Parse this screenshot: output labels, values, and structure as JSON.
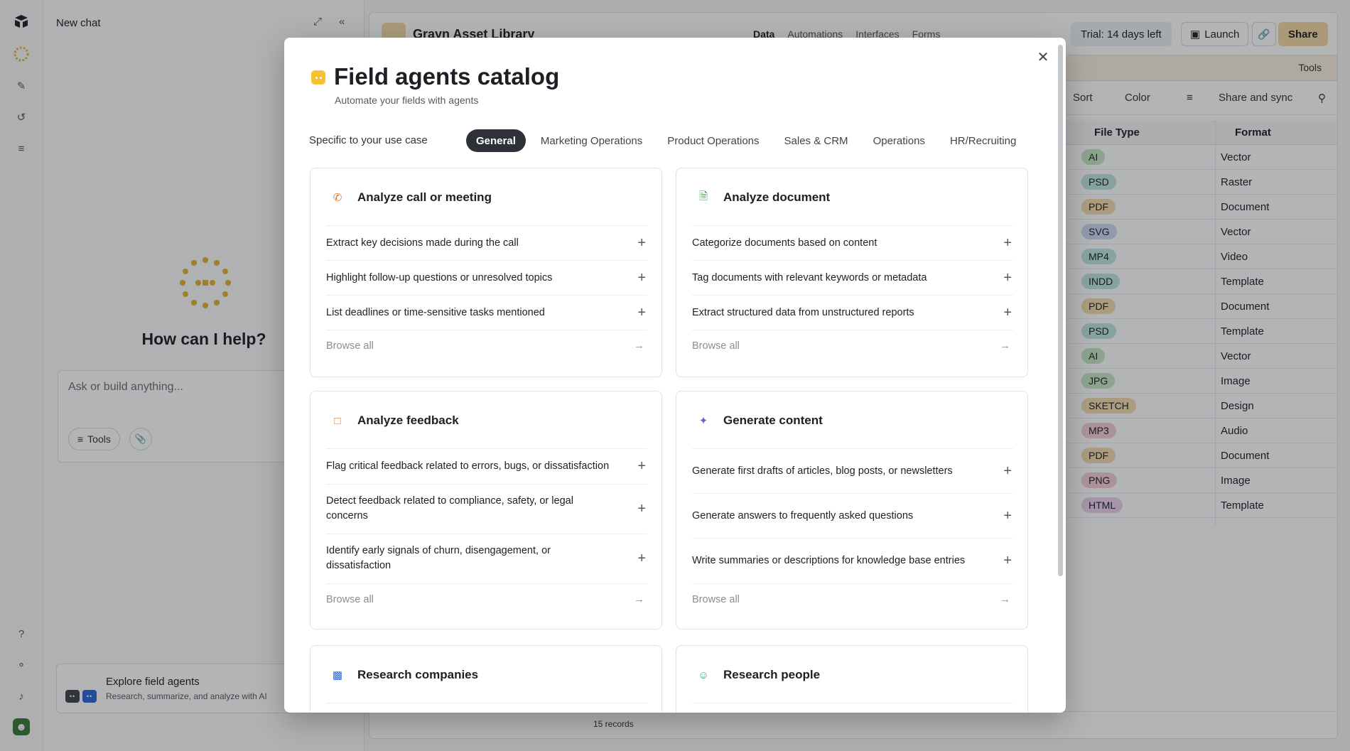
{
  "chat": {
    "title": "New chat",
    "heading": "How can I help?",
    "input_placeholder": "Ask or build anything...",
    "tools_label": "Tools",
    "explore_title": "Explore field agents",
    "explore_subtitle": "Research, summarize, and analyze with AI"
  },
  "base": {
    "name": "Grayn Asset Library",
    "nav": [
      "Data",
      "Automations",
      "Interfaces",
      "Forms"
    ],
    "trial": "Trial: 14 days left",
    "launch": "Launch",
    "share": "Share",
    "tools": "Tools",
    "view_buttons": {
      "sort": "Sort",
      "color": "Color",
      "share_sync": "Share and sync"
    },
    "columns": {
      "file_type": "File Type",
      "format": "Format"
    },
    "rows": [
      {
        "type": "AI",
        "format": "Vector",
        "color": "#c6e8c4"
      },
      {
        "type": "PSD",
        "format": "Raster",
        "color": "#bfe6e2"
      },
      {
        "type": "PDF",
        "format": "Document",
        "color": "#f3dcb0"
      },
      {
        "type": "SVG",
        "format": "Vector",
        "color": "#cdd8f2"
      },
      {
        "type": "MP4",
        "format": "Video",
        "color": "#bfe6e2"
      },
      {
        "type": "INDD",
        "format": "Template",
        "color": "#bfe6e2"
      },
      {
        "type": "PDF",
        "format": "Document",
        "color": "#f3dcb0"
      },
      {
        "type": "PSD",
        "format": "Template",
        "color": "#bfe6e2"
      },
      {
        "type": "AI",
        "format": "Vector",
        "color": "#c6e8c4"
      },
      {
        "type": "JPG",
        "format": "Image",
        "color": "#c6e8c4"
      },
      {
        "type": "SKETCH",
        "format": "Design",
        "color": "#f3dcb0"
      },
      {
        "type": "MP3",
        "format": "Audio",
        "color": "#f4cfd6"
      },
      {
        "type": "PDF",
        "format": "Document",
        "color": "#f3dcb0"
      },
      {
        "type": "PNG",
        "format": "Image",
        "color": "#f4cfd6"
      },
      {
        "type": "HTML",
        "format": "Template",
        "color": "#ecd2ef"
      }
    ],
    "records": "15 records"
  },
  "modal": {
    "title": "Field agents catalog",
    "subtitle": "Automate your fields with agents",
    "tabs_label": "Specific to your use case",
    "tabs": [
      "General",
      "Marketing Operations",
      "Product Operations",
      "Sales & CRM",
      "Operations",
      "HR/Recruiting"
    ],
    "browse_all": "Browse all",
    "cards": [
      {
        "title": "Analyze call or meeting",
        "icon": "phone-icon",
        "items": [
          "Extract key decisions made during the call",
          "Highlight follow-up questions or unresolved topics",
          "List deadlines or time-sensitive tasks mentioned"
        ]
      },
      {
        "title": "Analyze document",
        "icon": "document-icon",
        "items": [
          "Categorize documents based on content",
          "Tag documents with relevant keywords or metadata",
          "Extract structured data from unstructured reports"
        ]
      },
      {
        "title": "Analyze feedback",
        "icon": "chat-bubble-icon",
        "items": [
          "Flag critical feedback related to errors, bugs, or dissatisfaction",
          "Detect feedback related to compliance, safety, or legal concerns",
          "Identify early signals of churn, disengagement, or dissatisfaction"
        ]
      },
      {
        "title": "Generate content",
        "icon": "sparkle-icon",
        "items": [
          "Generate first drafts of articles, blog posts, or newsletters",
          "Generate answers to frequently asked questions",
          "Write summaries or descriptions for knowledge base entries"
        ]
      },
      {
        "title": "Research companies",
        "icon": "building-icon",
        "items": []
      },
      {
        "title": "Research people",
        "icon": "people-icon",
        "items": []
      }
    ]
  }
}
